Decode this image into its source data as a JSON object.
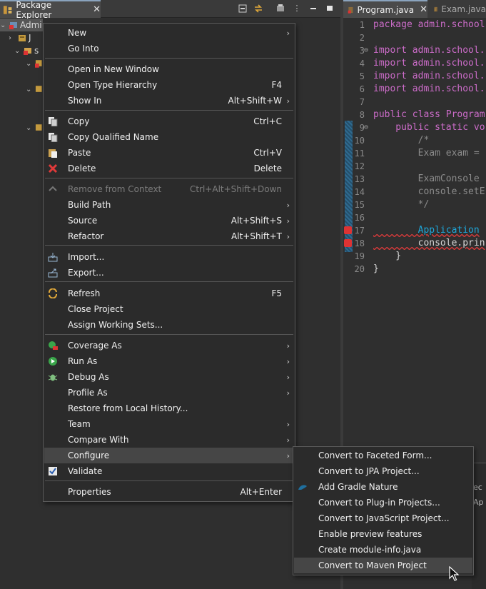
{
  "package_explorer": {
    "tab_label": "Package Explorer",
    "tree": [
      {
        "label": "Admi"
      },
      {
        "label": "J"
      },
      {
        "label": "s"
      }
    ]
  },
  "editor": {
    "tabs": [
      {
        "label": "Program.java"
      },
      {
        "label": "Exam.java"
      }
    ],
    "lines": [
      {
        "n": "1",
        "text": "package admin.school"
      },
      {
        "n": "2",
        "text": ""
      },
      {
        "n": "3",
        "text": "import admin.school."
      },
      {
        "n": "4",
        "text": "import admin.school."
      },
      {
        "n": "5",
        "text": "import admin.school."
      },
      {
        "n": "6",
        "text": "import admin.school."
      },
      {
        "n": "7",
        "text": ""
      },
      {
        "n": "8",
        "text": "public class Program"
      },
      {
        "n": "9",
        "text": "    public static vo"
      },
      {
        "n": "10",
        "text": "        /*"
      },
      {
        "n": "11",
        "text": "        Exam exam ="
      },
      {
        "n": "12",
        "text": ""
      },
      {
        "n": "13",
        "text": "        ExamConsole"
      },
      {
        "n": "14",
        "text": "        console.setE"
      },
      {
        "n": "15",
        "text": "        */"
      },
      {
        "n": "16",
        "text": ""
      },
      {
        "n": "17",
        "text": "        Application"
      },
      {
        "n": "18",
        "text": "        console.prin"
      },
      {
        "n": "19",
        "text": "    }"
      },
      {
        "n": "20",
        "text": "}"
      }
    ],
    "bottom_fragments": [
      "ec",
      "Ap"
    ]
  },
  "context_menu": {
    "items": [
      {
        "label": "New",
        "accel": "",
        "submenu": true,
        "icon": ""
      },
      {
        "label": "Go Into",
        "accel": "",
        "submenu": false,
        "icon": ""
      },
      {
        "label": "Open in New Window",
        "accel": "",
        "submenu": false,
        "icon": ""
      },
      {
        "label": "Open Type Hierarchy",
        "accel": "F4",
        "submenu": false,
        "icon": ""
      },
      {
        "label": "Show In",
        "accel": "Alt+Shift+W",
        "submenu": true,
        "icon": ""
      },
      {
        "label": "Copy",
        "accel": "Ctrl+C",
        "submenu": false,
        "icon": "copy-icon"
      },
      {
        "label": "Copy Qualified Name",
        "accel": "",
        "submenu": false,
        "icon": "copy-qualified-icon"
      },
      {
        "label": "Paste",
        "accel": "Ctrl+V",
        "submenu": false,
        "icon": "paste-icon"
      },
      {
        "label": "Delete",
        "accel": "Delete",
        "submenu": false,
        "icon": "delete-icon"
      },
      {
        "label": "Remove from Context",
        "accel": "Ctrl+Alt+Shift+Down",
        "submenu": false,
        "icon": "remove-context-icon",
        "disabled": true
      },
      {
        "label": "Build Path",
        "accel": "",
        "submenu": true,
        "icon": ""
      },
      {
        "label": "Source",
        "accel": "Alt+Shift+S",
        "submenu": true,
        "icon": ""
      },
      {
        "label": "Refactor",
        "accel": "Alt+Shift+T",
        "submenu": true,
        "icon": ""
      },
      {
        "label": "Import...",
        "accel": "",
        "submenu": false,
        "icon": "import-icon"
      },
      {
        "label": "Export...",
        "accel": "",
        "submenu": false,
        "icon": "export-icon"
      },
      {
        "label": "Refresh",
        "accel": "F5",
        "submenu": false,
        "icon": "refresh-icon"
      },
      {
        "label": "Close Project",
        "accel": "",
        "submenu": false,
        "icon": ""
      },
      {
        "label": "Assign Working Sets...",
        "accel": "",
        "submenu": false,
        "icon": ""
      },
      {
        "label": "Coverage As",
        "accel": "",
        "submenu": true,
        "icon": "coverage-icon"
      },
      {
        "label": "Run As",
        "accel": "",
        "submenu": true,
        "icon": "run-icon"
      },
      {
        "label": "Debug As",
        "accel": "",
        "submenu": true,
        "icon": "debug-icon"
      },
      {
        "label": "Profile As",
        "accel": "",
        "submenu": true,
        "icon": ""
      },
      {
        "label": "Restore from Local History...",
        "accel": "",
        "submenu": false,
        "icon": ""
      },
      {
        "label": "Team",
        "accel": "",
        "submenu": true,
        "icon": ""
      },
      {
        "label": "Compare With",
        "accel": "",
        "submenu": true,
        "icon": ""
      },
      {
        "label": "Configure",
        "accel": "",
        "submenu": true,
        "icon": "",
        "highlight": true
      },
      {
        "label": "Validate",
        "accel": "",
        "submenu": false,
        "icon": "validate-check-icon"
      },
      {
        "label": "Properties",
        "accel": "Alt+Enter",
        "submenu": false,
        "icon": ""
      }
    ]
  },
  "submenu": {
    "items": [
      {
        "label": "Convert to Faceted Form...",
        "icon": ""
      },
      {
        "label": "Convert to JPA Project...",
        "icon": ""
      },
      {
        "label": "Add Gradle Nature",
        "icon": "gradle-icon"
      },
      {
        "label": "Convert to Plug-in Projects...",
        "icon": ""
      },
      {
        "label": "Convert to JavaScript Project...",
        "icon": ""
      },
      {
        "label": "Enable preview features",
        "icon": ""
      },
      {
        "label": "Create module-info.java",
        "icon": ""
      },
      {
        "label": "Convert to Maven Project",
        "icon": "",
        "highlight": true
      }
    ]
  }
}
